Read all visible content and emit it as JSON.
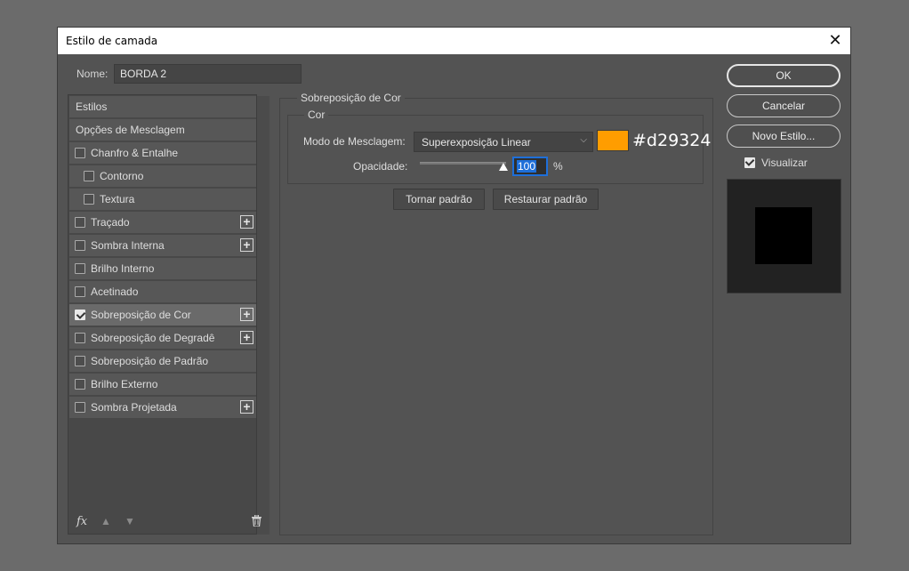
{
  "window": {
    "title": "Estilo de camada",
    "close_glyph": "✕"
  },
  "name_field": {
    "label": "Nome:",
    "value": "BORDA 2"
  },
  "styles_list": {
    "items": [
      {
        "label": "Estilos",
        "checkbox": null,
        "plus": false
      },
      {
        "label": "Opções de Mesclagem",
        "checkbox": null,
        "plus": false
      },
      {
        "label": "Chanfro & Entalhe",
        "checkbox": false,
        "plus": false
      },
      {
        "label": "Contorno",
        "checkbox": false,
        "plus": false,
        "indent": true
      },
      {
        "label": "Textura",
        "checkbox": false,
        "plus": false,
        "indent": true
      },
      {
        "label": "Traçado",
        "checkbox": false,
        "plus": true
      },
      {
        "label": "Sombra Interna",
        "checkbox": false,
        "plus": true
      },
      {
        "label": "Brilho Interno",
        "checkbox": false,
        "plus": false
      },
      {
        "label": "Acetinado",
        "checkbox": false,
        "plus": false
      },
      {
        "label": "Sobreposição de Cor",
        "checkbox": true,
        "plus": true,
        "selected": true
      },
      {
        "label": "Sobreposição de Degradê",
        "checkbox": false,
        "plus": true
      },
      {
        "label": "Sobreposição de Padrão",
        "checkbox": false,
        "plus": false
      },
      {
        "label": "Brilho Externo",
        "checkbox": false,
        "plus": false
      },
      {
        "label": "Sombra Projetada",
        "checkbox": false,
        "plus": true
      }
    ],
    "footer": {
      "fx": "fx",
      "up_icon": "arrow-up-icon",
      "down_icon": "arrow-down-icon",
      "trash_icon": "trash-icon"
    }
  },
  "panel": {
    "group_title": "Sobreposição de Cor",
    "subgroup_title": "Cor",
    "blend_mode_label": "Modo de Mesclagem:",
    "blend_mode_value": "Superexposição Linear",
    "color_swatch": "#ff9d00",
    "hex_label": "#d29324",
    "opacity_label": "Opacidade:",
    "opacity_value": "100",
    "opacity_level": 1.0,
    "opacity_unit": "%",
    "make_default": "Tornar padrão",
    "reset_default": "Restaurar padrão"
  },
  "right": {
    "ok": "OK",
    "cancel": "Cancelar",
    "new_style": "Novo Estilo...",
    "preview_label": "Visualizar",
    "preview_checked": true
  }
}
